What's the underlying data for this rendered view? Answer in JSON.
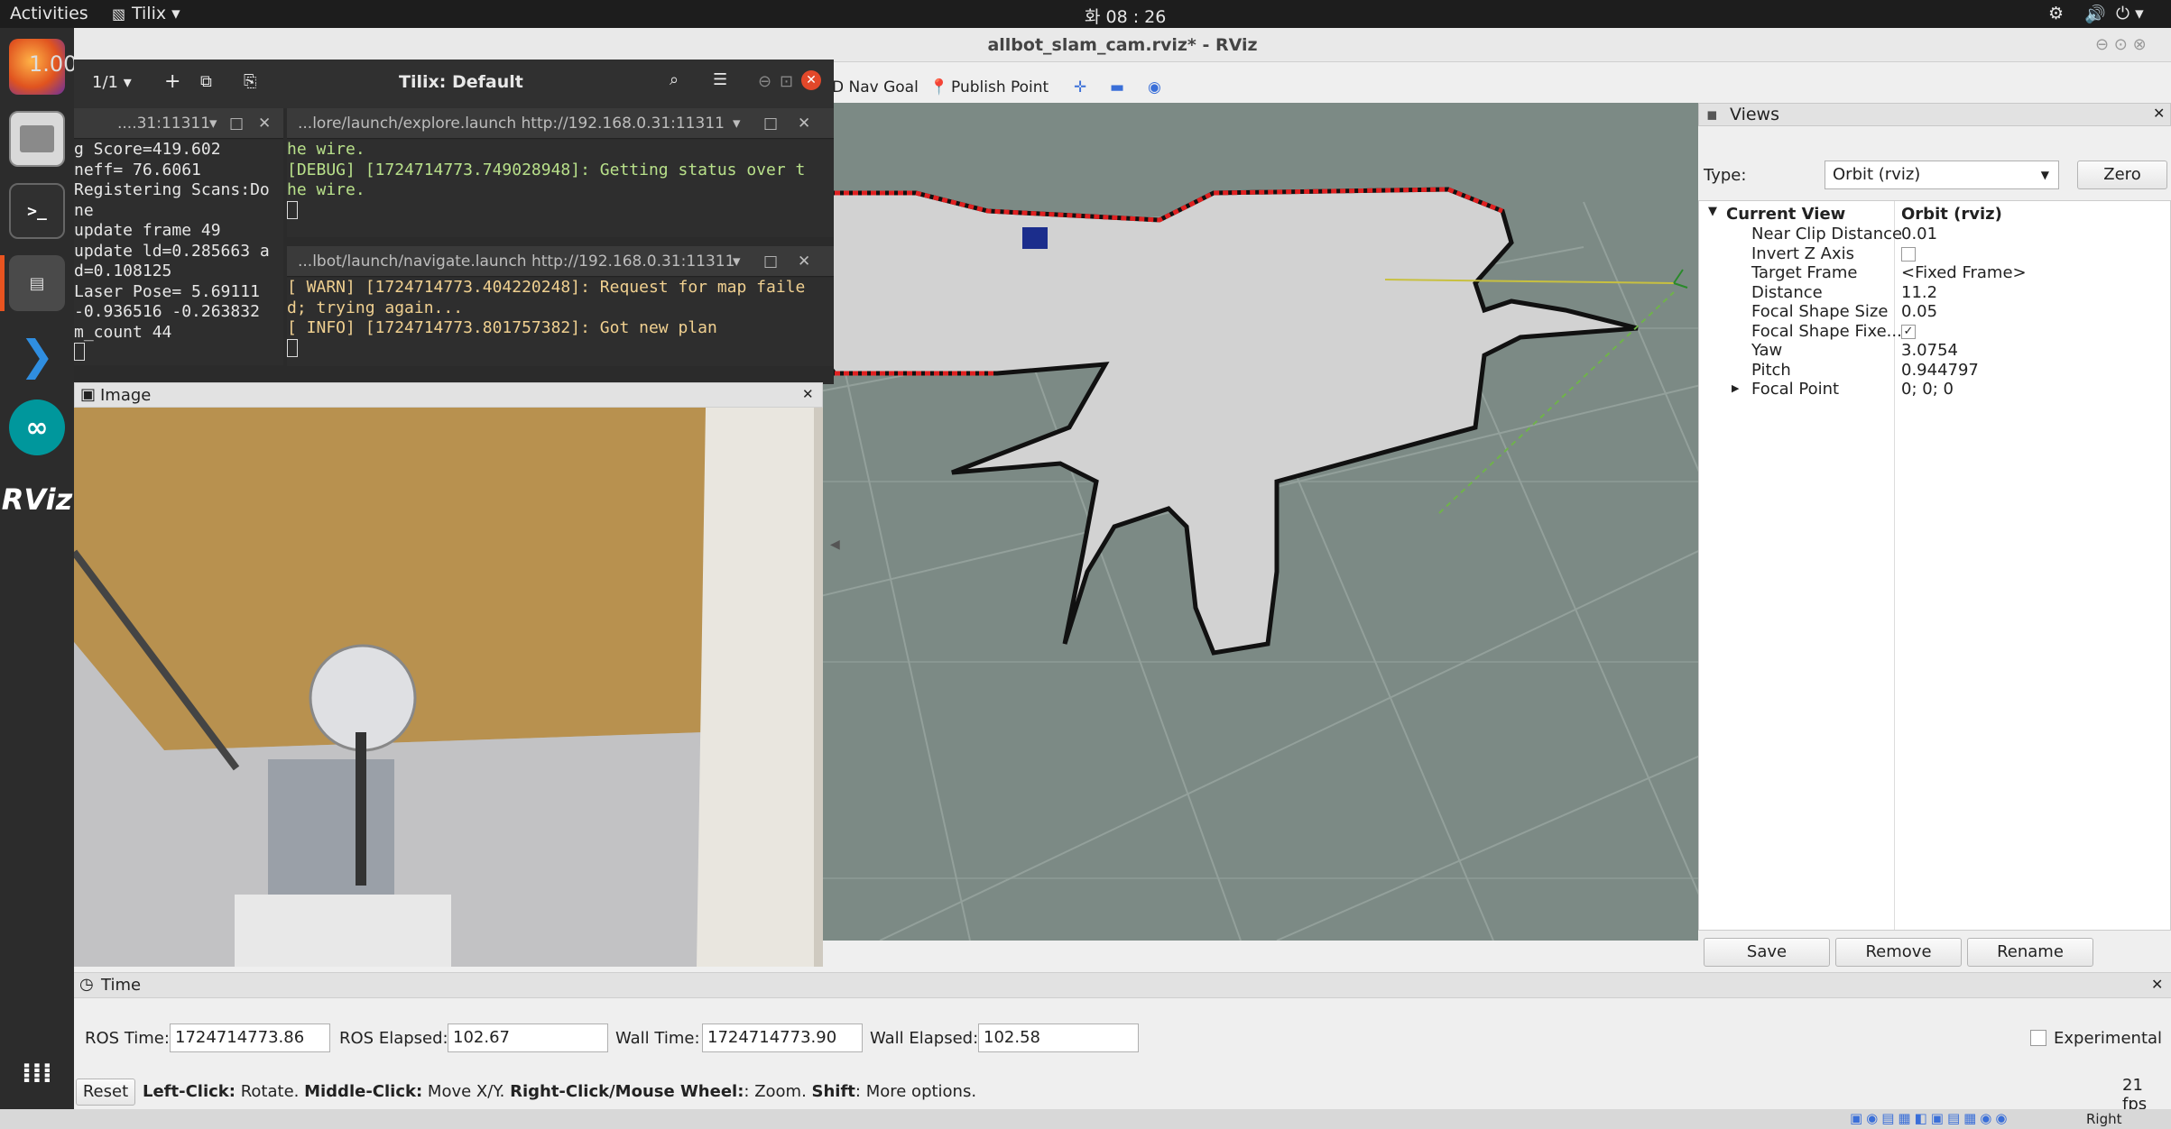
{
  "topbar": {
    "activities": "Activities",
    "app_menu": "Tilix",
    "clock": "화 08 : 26",
    "badge": "1.00"
  },
  "rviz": {
    "title": "allbot_slam_cam.rviz* - RViz",
    "tools": {
      "nav_goal": "D Nav Goal",
      "publish_point": "Publish Point"
    }
  },
  "tilix": {
    "title": "Tilix: Default",
    "session": "1/1",
    "pane_left_tab": "....31:11311",
    "pane_left_lines": [
      "g Score=419.602",
      "neff= 76.6061",
      "Registering Scans:Do",
      "ne",
      "update frame 49",
      "update ld=0.285663 a",
      "d=0.108125",
      "Laser Pose= 5.69111",
      "-0.936516 -0.263832",
      "m_count 44"
    ],
    "pane_top_tab": "...lore/launch/explore.launch http://192.168.0.31:11311",
    "pane_top_lines": [
      "he wire.",
      "[DEBUG] [1724714773.749028948]: Getting status over t",
      "he wire."
    ],
    "pane_bottom_tab": "...lbot/launch/navigate.launch http://192.168.0.31:11311",
    "pane_bottom_lines": [
      "[ WARN] [1724714773.404220248]: Request for map faile",
      "d; trying again...",
      "[ INFO] [1724714773.801757382]: Got new plan"
    ]
  },
  "image_panel": {
    "title": "Image"
  },
  "views": {
    "title": "Views",
    "type_label": "Type:",
    "type_value": "Orbit (rviz)",
    "zero_label": "Zero",
    "current_view_label": "Current View",
    "current_view_value": "Orbit (rviz)",
    "props": [
      {
        "k": "Near Clip Distance",
        "v": "0.01"
      },
      {
        "k": "Invert Z Axis",
        "v": ""
      },
      {
        "k": "Target Frame",
        "v": "<Fixed Frame>"
      },
      {
        "k": "Distance",
        "v": "11.2"
      },
      {
        "k": "Focal Shape Size",
        "v": "0.05"
      },
      {
        "k": "Focal Shape Fixe...",
        "v": "✓"
      },
      {
        "k": "Yaw",
        "v": "3.0754"
      },
      {
        "k": "Pitch",
        "v": "0.944797"
      },
      {
        "k": "Focal Point",
        "v": "0; 0; 0"
      }
    ],
    "save": "Save",
    "remove": "Remove",
    "rename": "Rename"
  },
  "time": {
    "title": "Time",
    "ros_time_label": "ROS Time:",
    "ros_time": "1724714773.86",
    "ros_elapsed_label": "ROS Elapsed:",
    "ros_elapsed": "102.67",
    "wall_time_label": "Wall Time:",
    "wall_time": "1724714773.90",
    "wall_elapsed_label": "Wall Elapsed:",
    "wall_elapsed": "102.58",
    "experimental": "Experimental"
  },
  "status": {
    "reset": "Reset",
    "h1": "Left-Click:",
    "t1": " Rotate. ",
    "h2": "Middle-Click:",
    "t2": " Move X/Y. ",
    "h3": "Right-Click/Mouse Wheel:",
    "t3": ": Zoom. ",
    "h4": "Shift",
    "t4": ": More options.",
    "fps": "21 fps"
  },
  "tray": {
    "right_control": "Right Control"
  },
  "colors": {
    "viewport_bg": "#7c8a85",
    "map_free": "#d2d2d2",
    "map_wall": "#111111",
    "laser": "#e02020",
    "terminal_green": "#b8e08a",
    "warn": "#f0d090"
  }
}
